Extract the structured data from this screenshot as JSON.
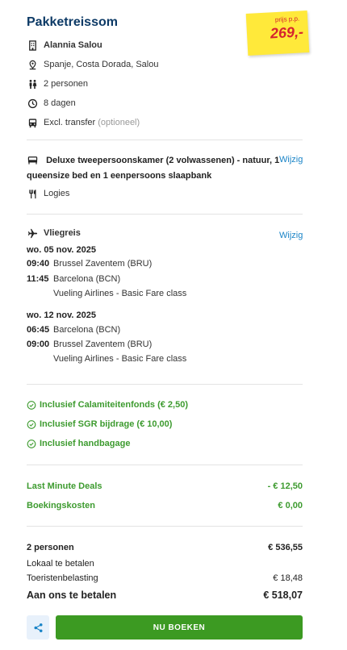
{
  "header": {
    "title": "Pakketreissom",
    "price_label": "prijs p.p.",
    "price_value": "269,-"
  },
  "summary": {
    "hotel": "Alannia Salou",
    "location": "Spanje, Costa Dorada, Salou",
    "persons": "2 personen",
    "duration": "8 dagen",
    "transfer": "Excl. transfer",
    "transfer_note": "(optioneel)"
  },
  "room": {
    "description": "Deluxe tweepersoonskamer (2 volwassenen) - natuur, 1 queensize bed en 1 eenpersoons slaapbank",
    "change_link": "Wijzig",
    "board": "Logies"
  },
  "flight": {
    "heading": "Vliegreis",
    "change_link": "Wijzig",
    "outbound": {
      "date": "wo. 05 nov. 2025",
      "depart_time": "09:40",
      "depart_place": "Brussel Zaventem (BRU)",
      "arrive_time": "11:45",
      "arrive_place": "Barcelona (BCN)",
      "carrier": "Vueling Airlines - Basic Fare class"
    },
    "return": {
      "date": "wo. 12 nov. 2025",
      "depart_time": "06:45",
      "depart_place": "Barcelona (BCN)",
      "arrive_time": "09:00",
      "arrive_place": "Brussel Zaventem (BRU)",
      "carrier": "Vueling Airlines - Basic Fare class"
    }
  },
  "inclusions": [
    "Inclusief Calamiteitenfonds (€ 2,50)",
    "Inclusief SGR bijdrage (€ 10,00)",
    "Inclusief handbagage"
  ],
  "discounts": [
    {
      "label": "Last Minute Deals",
      "value": "- € 12,50"
    },
    {
      "label": "Boekingskosten",
      "value": "€ 0,00"
    }
  ],
  "totals": {
    "persons_label": "2 personen",
    "persons_value": "€ 536,55",
    "local_label": "Lokaal te betalen",
    "tax_label": "Toeristenbelasting",
    "tax_value": "€ 18,48",
    "pay_label": "Aan ons te betalen",
    "pay_value": "€ 518,07"
  },
  "actions": {
    "book_label": "NU BOEKEN"
  },
  "colors": {
    "title": "#0d3a66",
    "accent_green": "#3c9a22",
    "link_blue": "#1a84c7",
    "price_red": "#d5232e",
    "sticker_yellow": "#ffe93a"
  }
}
